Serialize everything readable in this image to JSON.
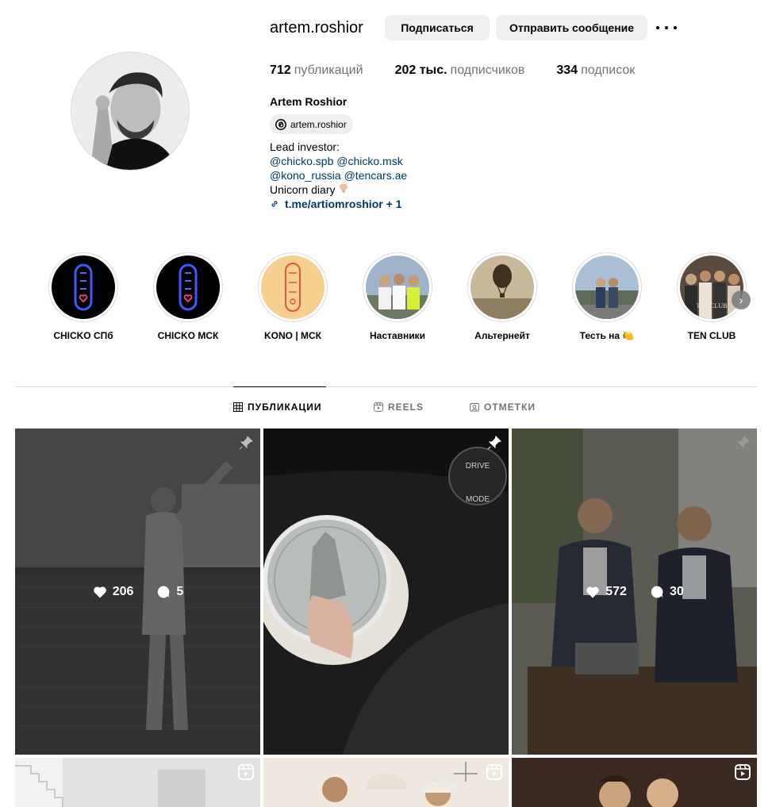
{
  "profile": {
    "username": "artem.roshior",
    "follow_label": "Подписаться",
    "message_label": "Отправить сообщение",
    "full_name": "Artem Roshior",
    "threads_handle": "artem.roshior",
    "stats": [
      {
        "value": "712",
        "label": "публикаций"
      },
      {
        "value": "202 тыс.",
        "label": "подписчиков"
      },
      {
        "value": "334",
        "label": "подписок"
      }
    ],
    "bio": {
      "line1": "Lead investor:",
      "mention1": "@chicko.spb",
      "mention2": "@chicko.msk",
      "mention3": "@kono_russia",
      "mention4": "@tencars.ae",
      "line4": "Unicorn diary",
      "link": "t.me/artiomroshior + 1"
    }
  },
  "highlights": [
    {
      "label": "CHICKO СПб",
      "icon": "chicko-neon-logo"
    },
    {
      "label": "CHICKO МСК",
      "icon": "chicko-neon-logo"
    },
    {
      "label": "KONO | МСК",
      "icon": "kono-logo"
    },
    {
      "label": "Наставники",
      "icon": "people-photo"
    },
    {
      "label": "Альтернейт",
      "icon": "balloon-photo"
    },
    {
      "label": "Тесть на 🍋",
      "icon": "people-photo"
    },
    {
      "label": "TEN CLUB",
      "icon": "group-photo"
    }
  ],
  "tabs": [
    {
      "label": "ПУБЛИКАЦИИ",
      "icon": "grid-icon",
      "active": true
    },
    {
      "label": "REELS",
      "icon": "reels-icon",
      "active": false
    },
    {
      "label": "ОТМЕТКИ",
      "icon": "tagged-icon",
      "active": false
    }
  ],
  "posts": [
    {
      "likes": "206",
      "comments": "5",
      "pinned": true
    },
    {
      "likes": "",
      "comments": "",
      "pinned": true
    },
    {
      "likes": "572",
      "comments": "30",
      "pinned": true
    },
    {
      "likes": "",
      "comments": "",
      "reel": true
    },
    {
      "likes": "",
      "comments": "",
      "reel": true
    },
    {
      "likes": "",
      "comments": "",
      "reel": true
    }
  ],
  "colors": {
    "link": "#00376b",
    "muted": "#737373",
    "button_bg": "#efefef",
    "border": "#dbdbdb"
  }
}
